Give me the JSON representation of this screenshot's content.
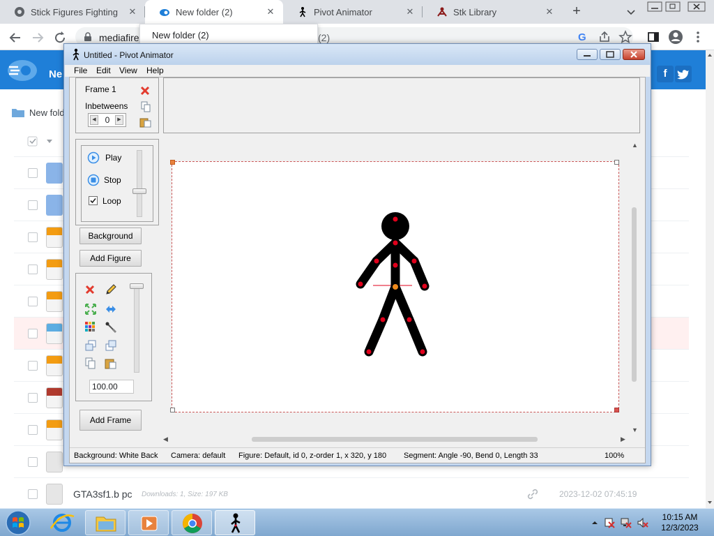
{
  "browser": {
    "tabs": [
      {
        "title": "Stick Figures Fighting",
        "active": false
      },
      {
        "title": "New folder (2)",
        "active": true
      },
      {
        "title": "Pivot Animator",
        "active": false
      },
      {
        "title": "Stk Library",
        "active": false
      }
    ],
    "tooltip": "New folder (2)",
    "address": "mediafire",
    "address_tail": "(2)"
  },
  "page": {
    "header_title": "Ne",
    "breadcrumb": "New fold",
    "visible_file": {
      "name": "GTA3sf1.b pc",
      "meta": "Downloads: 1, Size: 197 KB",
      "date": "2023-12-02 07:45:19"
    }
  },
  "app": {
    "title": "Untitled - Pivot Animator",
    "menu": [
      "File",
      "Edit",
      "View",
      "Help"
    ],
    "frame_panel": {
      "frame_label": "Frame 1",
      "inbetweens_label": "Inbetweens",
      "inbetweens_value": "0"
    },
    "playback": {
      "play": "Play",
      "stop": "Stop",
      "loop": "Loop",
      "loop_checked": true
    },
    "buttons": {
      "background": "Background",
      "add_figure": "Add Figure",
      "add_frame": "Add Frame"
    },
    "scale_value": "100.00",
    "status": {
      "background": "Background: White Back",
      "camera": "Camera: default",
      "figure": "Figure: Default,  id 0,  z-order 1,  x 320, y 180",
      "segment": "Segment: Angle -90,  Bend 0,  Length 33",
      "zoom": "100%"
    }
  },
  "taskbar": {
    "clock_time": "10:15 AM",
    "clock_date": "12/3/2023"
  },
  "colors": {
    "mediafire_blue": "#1f7fd8",
    "joint_red": "#e0001b",
    "joint_orange": "#f08a1c"
  }
}
